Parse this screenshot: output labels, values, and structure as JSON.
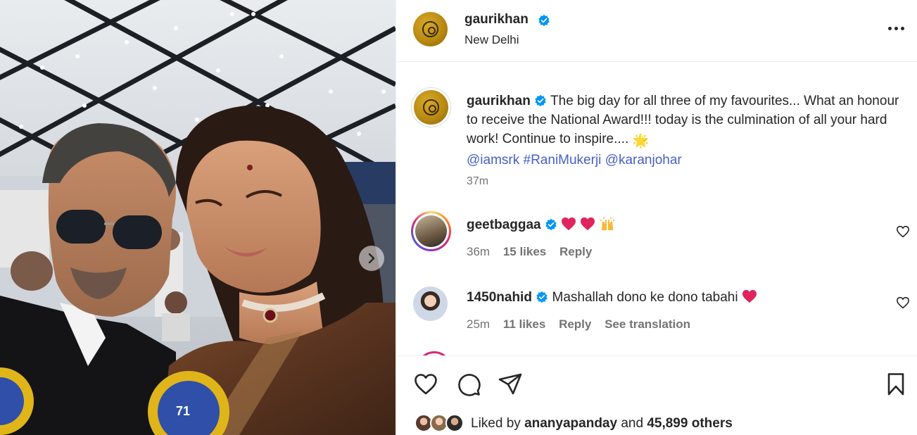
{
  "post": {
    "author": "gaurikhan",
    "location": "New Delhi",
    "caption": {
      "author": "gaurikhan",
      "text": "The big day for all three of my favourites... What an honour to receive the National Award!!! today is the culmination of all your hard work! Continue to inspire....",
      "sun_emoji": "🌟",
      "tag_1": "@iamsrk",
      "tag_2": "#RaniMukerji",
      "tag_3": "@karanjohar",
      "time": "37m"
    },
    "award_badge_text": "71"
  },
  "comments": [
    {
      "username": "geetbaggaa",
      "text": "",
      "time": "36m",
      "likes": "15 likes",
      "reply_label": "Reply"
    },
    {
      "username": "1450nahid",
      "text": "Mashallah dono ke dono tabahi",
      "time": "25m",
      "likes": "11 likes",
      "reply_label": "Reply",
      "translate_label": "See translation"
    }
  ],
  "liked_by": {
    "prefix": "Liked by",
    "user": "ananyapanday",
    "connector": "and",
    "others": "45,899 others"
  },
  "icons": {
    "more": "more-options-icon",
    "verified": "verified-badge-icon",
    "like": "heart-icon",
    "comment": "comment-icon",
    "share": "share-icon",
    "save": "bookmark-icon",
    "next": "chevron-right-icon"
  },
  "colors": {
    "verified": "#0095f6",
    "link": "#00376b",
    "tag": "#4760c8",
    "secondary": "#737373",
    "heart_emoji": "#e0245e"
  }
}
